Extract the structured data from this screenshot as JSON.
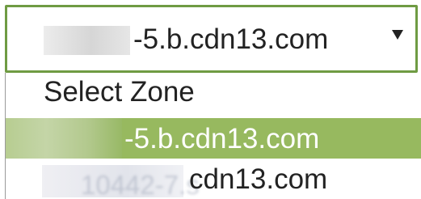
{
  "zone_select": {
    "selected_value": "-5.b.cdn13.com",
    "options": [
      {
        "label": "Select Zone"
      },
      {
        "label": "-5.b.cdn13.com"
      },
      {
        "label": "cdn13.com",
        "partial_text": "10442-7.s"
      }
    ]
  },
  "colors": {
    "border": "#6f9b43",
    "highlight": "#97b95f",
    "text": "#222222",
    "highlight_text": "#ffffff"
  },
  "icons": {
    "dropdown_arrow": "dropdown-arrow-icon"
  }
}
